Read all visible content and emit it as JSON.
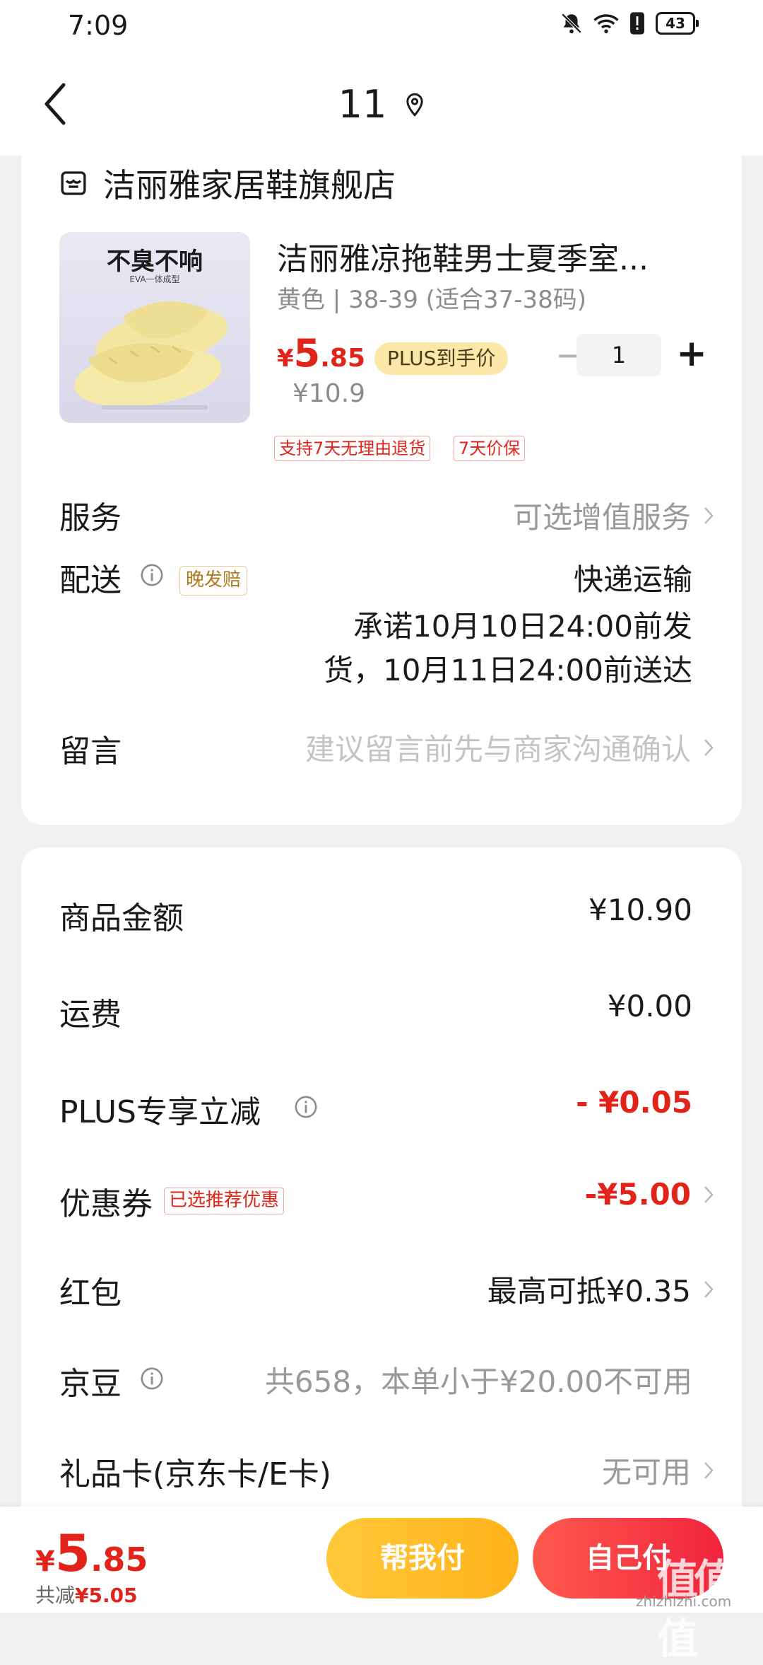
{
  "status_bar": {
    "time": "7:09",
    "battery": "43",
    "icons": [
      "bell-muted-icon",
      "wifi-icon",
      "alert-icon",
      "battery-icon"
    ]
  },
  "nav": {
    "title": "11",
    "icons": [
      "back-icon",
      "location-pin-icon"
    ]
  },
  "store": {
    "name": "洁丽雅家居鞋旗舰店",
    "icon": "store-icon"
  },
  "product": {
    "image_text": "不臭不响",
    "image_subtext": "EVA一体成型",
    "title": "洁丽雅凉拖鞋男士夏季室...",
    "spec": "黄色 | 38-39 (适合37-38码)",
    "price_yen": "¥",
    "price_int": "5",
    "price_dec": ".85",
    "plus_badge": "PLUS到手价",
    "original_price": "¥10.9",
    "quantity": "1",
    "minus": "−",
    "plus": "+",
    "tags": [
      "支持7天无理由退货",
      "7天价保"
    ]
  },
  "rows": {
    "service": {
      "label": "服务",
      "value": "可选增值服务"
    },
    "delivery": {
      "label": "配送",
      "badge": "晚发赔",
      "method": "快递运输",
      "promise_line1": "承诺10月10日24:00前发",
      "promise_line2": "货，10月11日24:00前送达"
    },
    "message": {
      "label": "留言",
      "placeholder": "建议留言前先与商家沟通确认"
    }
  },
  "summary": {
    "goods_amount": {
      "label": "商品金额",
      "value": "¥10.90"
    },
    "shipping": {
      "label": "运费",
      "value": "¥0.00"
    },
    "plus_discount": {
      "label": "PLUS专享立减",
      "value": "- ¥0.05"
    },
    "coupon": {
      "label": "优惠券",
      "badge": "已选推荐优惠",
      "value": "-¥5.00"
    },
    "red_packet": {
      "label": "红包",
      "value": "最高可抵¥0.35"
    },
    "jingdou": {
      "label": "京豆",
      "value": "共658，本单小于¥20.00不可用"
    },
    "gift_card": {
      "label": "礼品卡(京东卡/E卡)",
      "value": "无可用"
    }
  },
  "bottom": {
    "total_yen": "¥",
    "total_int": "5",
    "total_dec": ".85",
    "saved_label": "共减",
    "saved_value": "¥5.05",
    "help_pay": "帮我付",
    "self_pay": "自己付"
  },
  "watermark": {
    "logo": "值值值",
    "site": "zhizhizhi.com"
  },
  "colors": {
    "accent_red": "#e2231a",
    "plus_gold": "#fbe7a8",
    "help_button": "#ffb21a",
    "self_button": "#f0243d"
  }
}
